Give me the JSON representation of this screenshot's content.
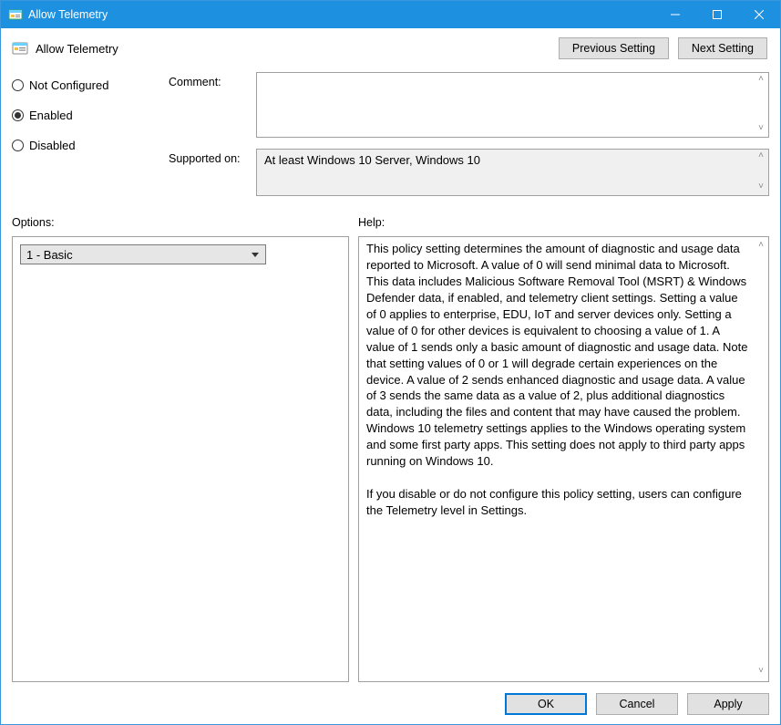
{
  "titlebar": {
    "title": "Allow Telemetry"
  },
  "header": {
    "policy_title": "Allow Telemetry",
    "previous": "Previous Setting",
    "next": "Next Setting"
  },
  "state": {
    "not_configured": "Not Configured",
    "enabled": "Enabled",
    "disabled": "Disabled",
    "selected": "enabled"
  },
  "labels": {
    "comment": "Comment:",
    "supported_on": "Supported on:",
    "options": "Options:",
    "help": "Help:"
  },
  "comment_value": "",
  "supported_on_value": "At least Windows 10 Server, Windows 10",
  "options": {
    "selected": "1 - Basic"
  },
  "help_text_p1": "This policy setting determines the amount of diagnostic and usage data reported to Microsoft. A value of 0 will send minimal data to Microsoft. This data includes Malicious Software Removal Tool (MSRT) & Windows Defender data, if enabled, and telemetry client settings. Setting a value of 0 applies to enterprise, EDU, IoT and server devices only. Setting a value of 0 for other devices is equivalent to choosing a value of 1. A value of 1 sends only a basic amount of diagnostic and usage data. Note that setting values of 0 or 1 will degrade certain experiences on the device. A value of 2 sends enhanced diagnostic and usage data. A value of 3 sends the same data as a value of 2, plus additional diagnostics data, including the files and content that may have caused the problem. Windows 10 telemetry settings applies to the Windows operating system and some first party apps. This setting does not apply to third party apps running on Windows 10.",
  "help_text_p2": "If you disable or do not configure this policy setting, users can configure the Telemetry level in Settings.",
  "buttons": {
    "ok": "OK",
    "cancel": "Cancel",
    "apply": "Apply"
  }
}
